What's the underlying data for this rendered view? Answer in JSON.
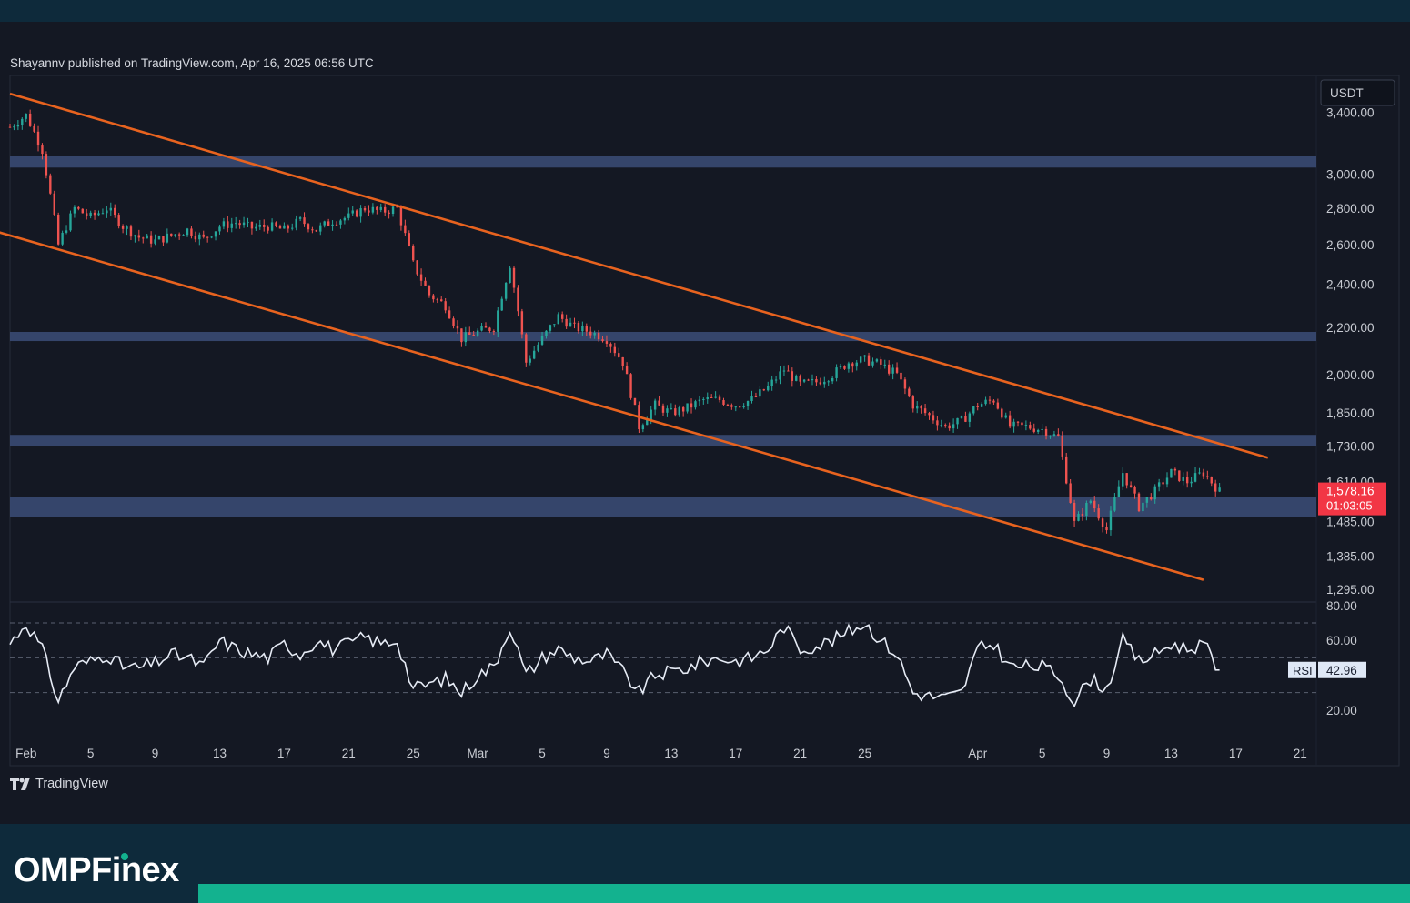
{
  "header": {
    "publisher_text": "Shayannv published on TradingView.com, Apr 16, 2025 06:56 UTC"
  },
  "brand": {
    "tradingview_label": "TradingView",
    "omp_text": "OMPF",
    "omp_text_b": "inex"
  },
  "colors": {
    "background": "#141823",
    "frame": "#0e2a3b",
    "accent": "#13b28f",
    "up_candle": "#26a69a",
    "down_candle": "#ef5350",
    "channel_line": "#e8631f",
    "zone_fill": "#3b4e78",
    "rsi_line": "#e6ebf5",
    "price_badge": "#f23645"
  },
  "chart_data": [
    {
      "type": "candlestick",
      "symbol_currency": "USDT",
      "y_scale": "log",
      "ylim": [
        1295,
        3550
      ],
      "x_range": [
        "2025-01-31",
        "2025-04-22"
      ],
      "y_ticks": [
        "3,400.00",
        "3,000.00",
        "2,800.00",
        "2,600.00",
        "2,400.00",
        "2,200.00",
        "2,000.00",
        "1,850.00",
        "1,730.00",
        "1,610.00",
        "1,485.00",
        "1,385.00",
        "1,295.00"
      ],
      "y_tick_values": [
        3400,
        3000,
        2800,
        2600,
        2400,
        2200,
        2000,
        1850,
        1730,
        1610,
        1485,
        1385,
        1295
      ],
      "x_ticks": [
        "Feb",
        "5",
        "9",
        "13",
        "17",
        "21",
        "25",
        "Mar",
        "5",
        "9",
        "13",
        "17",
        "21",
        "25",
        "Apr",
        "5",
        "9",
        "13",
        "17",
        "21"
      ],
      "x_tick_dates": [
        "2025-02-01",
        "2025-02-05",
        "2025-02-09",
        "2025-02-13",
        "2025-02-17",
        "2025-02-21",
        "2025-02-25",
        "2025-03-01",
        "2025-03-05",
        "2025-03-09",
        "2025-03-13",
        "2025-03-17",
        "2025-03-21",
        "2025-03-25",
        "2025-04-01",
        "2025-04-05",
        "2025-04-09",
        "2025-04-13",
        "2025-04-17",
        "2025-04-21"
      ],
      "last_price": "1,578.16",
      "countdown": "01:03:05",
      "price_path": [
        [
          "2025-01-31",
          3300
        ],
        [
          "2025-02-01",
          3380
        ],
        [
          "2025-02-02",
          3150
        ],
        [
          "2025-02-03",
          2600
        ],
        [
          "2025-02-04",
          2800
        ],
        [
          "2025-02-05",
          2750
        ],
        [
          "2025-02-06",
          2800
        ],
        [
          "2025-02-07",
          2700
        ],
        [
          "2025-02-08",
          2640
        ],
        [
          "2025-02-09",
          2620
        ],
        [
          "2025-02-10",
          2650
        ],
        [
          "2025-02-11",
          2680
        ],
        [
          "2025-02-12",
          2630
        ],
        [
          "2025-02-13",
          2700
        ],
        [
          "2025-02-14",
          2720
        ],
        [
          "2025-02-15",
          2690
        ],
        [
          "2025-02-16",
          2700
        ],
        [
          "2025-02-17",
          2680
        ],
        [
          "2025-02-18",
          2730
        ],
        [
          "2025-02-19",
          2680
        ],
        [
          "2025-02-20",
          2730
        ],
        [
          "2025-02-21",
          2750
        ],
        [
          "2025-02-22",
          2800
        ],
        [
          "2025-02-23",
          2780
        ],
        [
          "2025-02-24",
          2800
        ],
        [
          "2025-02-25",
          2500
        ],
        [
          "2025-02-26",
          2350
        ],
        [
          "2025-02-27",
          2300
        ],
        [
          "2025-02-28",
          2150
        ],
        [
          "2025-03-01",
          2180
        ],
        [
          "2025-03-02",
          2200
        ],
        [
          "2025-03-03",
          2500
        ],
        [
          "2025-03-04",
          2050
        ],
        [
          "2025-03-05",
          2150
        ],
        [
          "2025-03-06",
          2250
        ],
        [
          "2025-03-07",
          2200
        ],
        [
          "2025-03-08",
          2180
        ],
        [
          "2025-03-09",
          2150
        ],
        [
          "2025-03-10",
          2050
        ],
        [
          "2025-03-11",
          1800
        ],
        [
          "2025-03-12",
          1880
        ],
        [
          "2025-03-13",
          1850
        ],
        [
          "2025-03-14",
          1870
        ],
        [
          "2025-03-15",
          1900
        ],
        [
          "2025-03-16",
          1900
        ],
        [
          "2025-03-17",
          1880
        ],
        [
          "2025-03-18",
          1900
        ],
        [
          "2025-03-19",
          1950
        ],
        [
          "2025-03-20",
          2020
        ],
        [
          "2025-03-21",
          1960
        ],
        [
          "2025-03-22",
          1970
        ],
        [
          "2025-03-23",
          2000
        ],
        [
          "2025-03-24",
          2050
        ],
        [
          "2025-03-25",
          2060
        ],
        [
          "2025-03-26",
          2040
        ],
        [
          "2025-03-27",
          2000
        ],
        [
          "2025-03-28",
          1880
        ],
        [
          "2025-03-29",
          1840
        ],
        [
          "2025-03-30",
          1800
        ],
        [
          "2025-03-31",
          1820
        ],
        [
          "2025-04-01",
          1880
        ],
        [
          "2025-04-02",
          1900
        ],
        [
          "2025-04-03",
          1800
        ],
        [
          "2025-04-04",
          1800
        ],
        [
          "2025-04-05",
          1790
        ],
        [
          "2025-04-06",
          1760
        ],
        [
          "2025-04-07",
          1480
        ],
        [
          "2025-04-08",
          1550
        ],
        [
          "2025-04-09",
          1460
        ],
        [
          "2025-04-10",
          1640
        ],
        [
          "2025-04-11",
          1530
        ],
        [
          "2025-04-12",
          1580
        ],
        [
          "2025-04-13",
          1640
        ],
        [
          "2025-04-14",
          1610
        ],
        [
          "2025-04-15",
          1640
        ],
        [
          "2025-04-16",
          1578
        ]
      ],
      "support_resistance_zones": [
        {
          "low": 3040,
          "high": 3110
        },
        {
          "low": 2140,
          "high": 2180
        },
        {
          "low": 1730,
          "high": 1770
        },
        {
          "low": 1500,
          "high": 1560
        }
      ],
      "channel_lines": [
        {
          "from": [
            "2025-01-31",
            3530
          ],
          "to": [
            "2025-04-19",
            1690
          ]
        },
        {
          "from": [
            "2025-01-30",
            2675
          ],
          "to": [
            "2025-04-15",
            1320
          ]
        }
      ]
    },
    {
      "type": "line",
      "indicator": "RSI",
      "ylim": [
        10,
        82
      ],
      "y_ticks": [
        "80.00",
        "60.00",
        "20.00"
      ],
      "y_tick_values": [
        80,
        60,
        20
      ],
      "bands": [
        70,
        50,
        30
      ],
      "last_value": "42.96",
      "indicator_label": "RSI",
      "rsi_path": [
        [
          "2025-01-31",
          58
        ],
        [
          "2025-02-01",
          70
        ],
        [
          "2025-02-02",
          55
        ],
        [
          "2025-02-03",
          25
        ],
        [
          "2025-02-04",
          45
        ],
        [
          "2025-02-05",
          48
        ],
        [
          "2025-02-06",
          52
        ],
        [
          "2025-02-07",
          45
        ],
        [
          "2025-02-08",
          44
        ],
        [
          "2025-02-09",
          47
        ],
        [
          "2025-02-10",
          52
        ],
        [
          "2025-02-11",
          50
        ],
        [
          "2025-02-12",
          45
        ],
        [
          "2025-02-13",
          60
        ],
        [
          "2025-02-14",
          55
        ],
        [
          "2025-02-15",
          52
        ],
        [
          "2025-02-16",
          50
        ],
        [
          "2025-02-17",
          58
        ],
        [
          "2025-02-18",
          52
        ],
        [
          "2025-02-19",
          60
        ],
        [
          "2025-02-20",
          55
        ],
        [
          "2025-02-21",
          58
        ],
        [
          "2025-02-22",
          62
        ],
        [
          "2025-02-23",
          58
        ],
        [
          "2025-02-24",
          60
        ],
        [
          "2025-02-25",
          32
        ],
        [
          "2025-02-26",
          35
        ],
        [
          "2025-02-27",
          38
        ],
        [
          "2025-02-28",
          30
        ],
        [
          "2025-03-01",
          40
        ],
        [
          "2025-03-02",
          45
        ],
        [
          "2025-03-03",
          68
        ],
        [
          "2025-03-04",
          40
        ],
        [
          "2025-03-05",
          50
        ],
        [
          "2025-03-06",
          55
        ],
        [
          "2025-03-07",
          50
        ],
        [
          "2025-03-08",
          48
        ],
        [
          "2025-03-09",
          52
        ],
        [
          "2025-03-10",
          42
        ],
        [
          "2025-03-11",
          30
        ],
        [
          "2025-03-12",
          40
        ],
        [
          "2025-03-13",
          42
        ],
        [
          "2025-03-14",
          44
        ],
        [
          "2025-03-15",
          48
        ],
        [
          "2025-03-16",
          50
        ],
        [
          "2025-03-17",
          48
        ],
        [
          "2025-03-18",
          50
        ],
        [
          "2025-03-19",
          55
        ],
        [
          "2025-03-20",
          68
        ],
        [
          "2025-03-21",
          55
        ],
        [
          "2025-03-22",
          57
        ],
        [
          "2025-03-23",
          60
        ],
        [
          "2025-03-24",
          65
        ],
        [
          "2025-03-25",
          70
        ],
        [
          "2025-03-26",
          60
        ],
        [
          "2025-03-27",
          52
        ],
        [
          "2025-03-28",
          30
        ],
        [
          "2025-03-29",
          28
        ],
        [
          "2025-03-30",
          27
        ],
        [
          "2025-03-31",
          30
        ],
        [
          "2025-04-01",
          55
        ],
        [
          "2025-04-02",
          58
        ],
        [
          "2025-04-03",
          45
        ],
        [
          "2025-04-04",
          45
        ],
        [
          "2025-04-05",
          45
        ],
        [
          "2025-04-06",
          40
        ],
        [
          "2025-04-07",
          25
        ],
        [
          "2025-04-08",
          38
        ],
        [
          "2025-04-09",
          32
        ],
        [
          "2025-04-10",
          60
        ],
        [
          "2025-04-11",
          48
        ],
        [
          "2025-04-12",
          52
        ],
        [
          "2025-04-13",
          58
        ],
        [
          "2025-04-14",
          55
        ],
        [
          "2025-04-15",
          58
        ],
        [
          "2025-04-16",
          43
        ]
      ]
    }
  ]
}
